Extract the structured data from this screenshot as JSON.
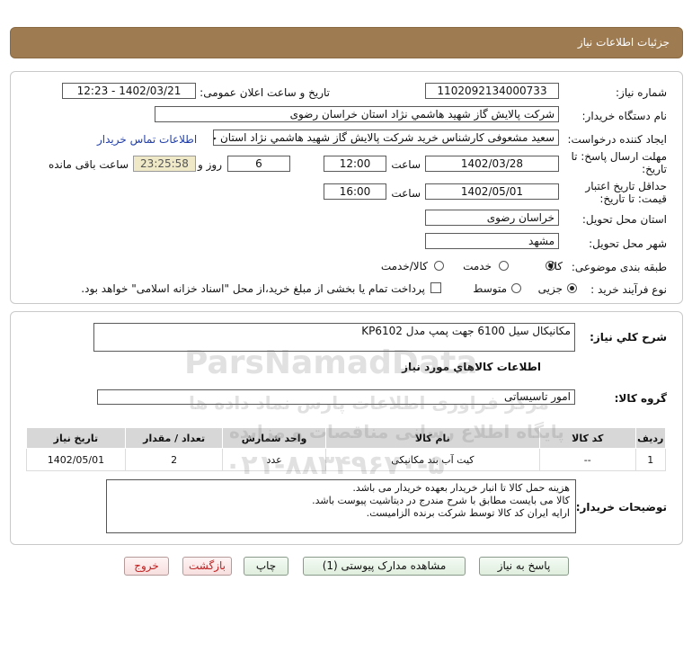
{
  "header": {
    "title": "جزئیات اطلاعات نیاز"
  },
  "form": {
    "need_number_label": "شماره نیاز:",
    "need_number": "1102092134000733",
    "announce_label": "تاریخ و ساعت اعلان عمومی:",
    "announce_value": "1402/03/21 - 12:23",
    "buyer_org_label": "نام دستگاه خریدار:",
    "buyer_org": "شرکت پالایش گاز شهید هاشمي نژاد   استان خراسان رضوی",
    "creator_label": "ایجاد کننده درخواست:",
    "creator": "سعید مشعوفی کارشناس خرید شرکت پالایش گاز شهید هاشمي نژاد   استان خراسان رضوی",
    "contact_link": "اطلاعات تماس خریدار",
    "reply_deadline_label_1": "مهلت ارسال پاسخ: تا",
    "reply_deadline_label_2": "تاریخ:",
    "reply_date": "1402/03/28",
    "time_label": "ساعت",
    "reply_time": "12:00",
    "days_value": "6",
    "days_label": "روز و",
    "remaining_time": "23:25:58",
    "remaining_label": "ساعت باقی مانده",
    "validity_label_1": "حداقل تاریخ اعتبار",
    "validity_label_2": "قیمت: تا تاریخ:",
    "validity_date": "1402/05/01",
    "validity_time_label": "ساعت",
    "validity_time": "16:00",
    "province_label": "استان محل تحویل:",
    "province": "خراسان رضوی",
    "city_label": "شهر محل تحویل:",
    "city": "مشهد",
    "category_label": "طبقه بندی موضوعی:",
    "category_options": [
      "کالا",
      "خدمت",
      "کالا/خدمت"
    ],
    "process_label": "نوع فرآیند خرید :",
    "process_options": [
      "جزیی",
      "متوسط"
    ],
    "payment_note": "پرداخت تمام یا بخشی از مبلغ خرید،از محل \"اسناد خزانه اسلامی\" خواهد بود."
  },
  "summary": {
    "label": "شرح کلي نياز:",
    "value": "مکانیکال سیل 6100 جهت پمپ مدل KP6102",
    "items_title": "اطلاعات کالاهاي مورد نياز",
    "group_label": "گروه کالا:",
    "group_value": "امور تاسیساتی"
  },
  "table": {
    "headers": [
      "ردیف",
      "کد کالا",
      "نام کالا",
      "واحد شمارش",
      "تعداد / مقدار",
      "تاریخ نیاز"
    ],
    "rows": [
      [
        "1",
        "--",
        "کیت آب بند مکانیکی",
        "عدد",
        "2",
        "1402/05/01"
      ]
    ]
  },
  "notes": {
    "label": "توضیحات خریدار:",
    "lines": [
      "هزینه حمل کالا تا انبار خریدار بعهده خریدار می باشد.",
      "کالا می بایست مطابق با شرح مندرج در دیتاشیت پیوست باشد.",
      "ارایه ایران کد کالا توسط شرکت برنده الزامیست."
    ]
  },
  "buttons": {
    "reply": "پاسخ به نیاز",
    "attachments": "مشاهده مدارک پیوستی (1)",
    "print": "چاپ",
    "back": "بازگشت",
    "exit": "خروج"
  },
  "watermark": {
    "brand": "ParsNamadData",
    "line1": "مرکز فراوری اطلاعات پارس نماد داده ها",
    "line2": "پایگاه اطلاع رسانی مناقصات و مزایده",
    "phone": "۰۲۱-۸۸۳۴۹۶۷۰-۵"
  },
  "colors": {
    "header": "#9e7b50",
    "link": "#2340a8",
    "remaining_bg": "#efe9c8"
  }
}
